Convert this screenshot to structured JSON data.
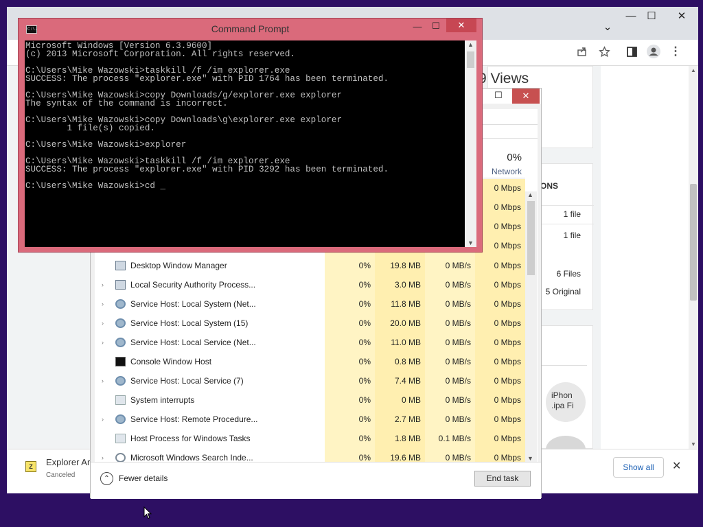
{
  "browser": {
    "window_buttons": {
      "minimize": "—",
      "maximize": "☐",
      "close": "✕"
    },
    "tab_dropdown": "⌄",
    "page": {
      "views_text": "9 Views",
      "section_heading": "ONS",
      "file_rows": [
        "1 file",
        "1 file"
      ],
      "files_count": "6 Files",
      "original_text": "5 Original",
      "thumb_text": "iPhon .ipa Fi"
    },
    "download": {
      "name": "Explorer Ar",
      "status": "Canceled",
      "show_all": "Show all",
      "close": "✕"
    }
  },
  "taskmgr": {
    "header": {
      "network_percent": "0%",
      "network_label": "Network"
    },
    "partial_network": [
      "0 Mbps",
      "0 Mbps",
      "0 Mbps",
      "0 Mbps"
    ],
    "rows": [
      {
        "expand": "",
        "icon": "win",
        "name": "Desktop Window Manager",
        "cpu": "0%",
        "memory": "19.8 MB",
        "disk": "0 MB/s",
        "network": "0 Mbps"
      },
      {
        "expand": "›",
        "icon": "win",
        "name": "Local Security Authority Process...",
        "cpu": "0%",
        "memory": "3.0 MB",
        "disk": "0 MB/s",
        "network": "0 Mbps"
      },
      {
        "expand": "›",
        "icon": "gear",
        "name": "Service Host: Local System (Net...",
        "cpu": "0%",
        "memory": "11.8 MB",
        "disk": "0 MB/s",
        "network": "0 Mbps"
      },
      {
        "expand": "›",
        "icon": "gear",
        "name": "Service Host: Local System (15)",
        "cpu": "0%",
        "memory": "20.0 MB",
        "disk": "0 MB/s",
        "network": "0 Mbps"
      },
      {
        "expand": "›",
        "icon": "gear",
        "name": "Service Host: Local Service (Net...",
        "cpu": "0%",
        "memory": "11.0 MB",
        "disk": "0 MB/s",
        "network": "0 Mbps"
      },
      {
        "expand": "",
        "icon": "cmd",
        "name": "Console Window Host",
        "cpu": "0%",
        "memory": "0.8 MB",
        "disk": "0 MB/s",
        "network": "0 Mbps"
      },
      {
        "expand": "›",
        "icon": "gear",
        "name": "Service Host: Local Service (7)",
        "cpu": "0%",
        "memory": "7.4 MB",
        "disk": "0 MB/s",
        "network": "0 Mbps"
      },
      {
        "expand": "",
        "icon": "sys",
        "name": "System interrupts",
        "cpu": "0%",
        "memory": "0 MB",
        "disk": "0 MB/s",
        "network": "0 Mbps"
      },
      {
        "expand": "›",
        "icon": "gear",
        "name": "Service Host: Remote Procedure...",
        "cpu": "0%",
        "memory": "2.7 MB",
        "disk": "0 MB/s",
        "network": "0 Mbps"
      },
      {
        "expand": "",
        "icon": "sys",
        "name": "Host Process for Windows Tasks",
        "cpu": "0%",
        "memory": "1.8 MB",
        "disk": "0.1 MB/s",
        "network": "0 Mbps"
      },
      {
        "expand": "›",
        "icon": "search",
        "name": "Microsoft Windows Search Inde...",
        "cpu": "0%",
        "memory": "19.6 MB",
        "disk": "0 MB/s",
        "network": "0 Mbps"
      }
    ],
    "footer": {
      "fewer_details": "Fewer details",
      "end_task": "End task"
    },
    "window_buttons": {
      "maximize": "☐",
      "close": "✕"
    }
  },
  "cmd": {
    "title": "Command Prompt",
    "icon_text": "C:\\.",
    "window_buttons": {
      "minimize": "—",
      "maximize": "☐",
      "close": "✕"
    },
    "output": "Microsoft Windows [Version 6.3.9600]\n(c) 2013 Microsoft Corporation. All rights reserved.\n\nC:\\Users\\Mike Wazowski>taskkill /f /im explorer.exe\nSUCCESS: The process \"explorer.exe\" with PID 1764 has been terminated.\n\nC:\\Users\\Mike Wazowski>copy Downloads/g/explorer.exe explorer\nThe syntax of the command is incorrect.\n\nC:\\Users\\Mike Wazowski>copy Downloads\\g\\explorer.exe explorer\n        1 file(s) copied.\n\nC:\\Users\\Mike Wazowski>explorer\n\nC:\\Users\\Mike Wazowski>taskkill /f /im explorer.exe\nSUCCESS: The process \"explorer.exe\" with PID 3292 has been terminated.\n\nC:\\Users\\Mike Wazowski>cd _"
  }
}
